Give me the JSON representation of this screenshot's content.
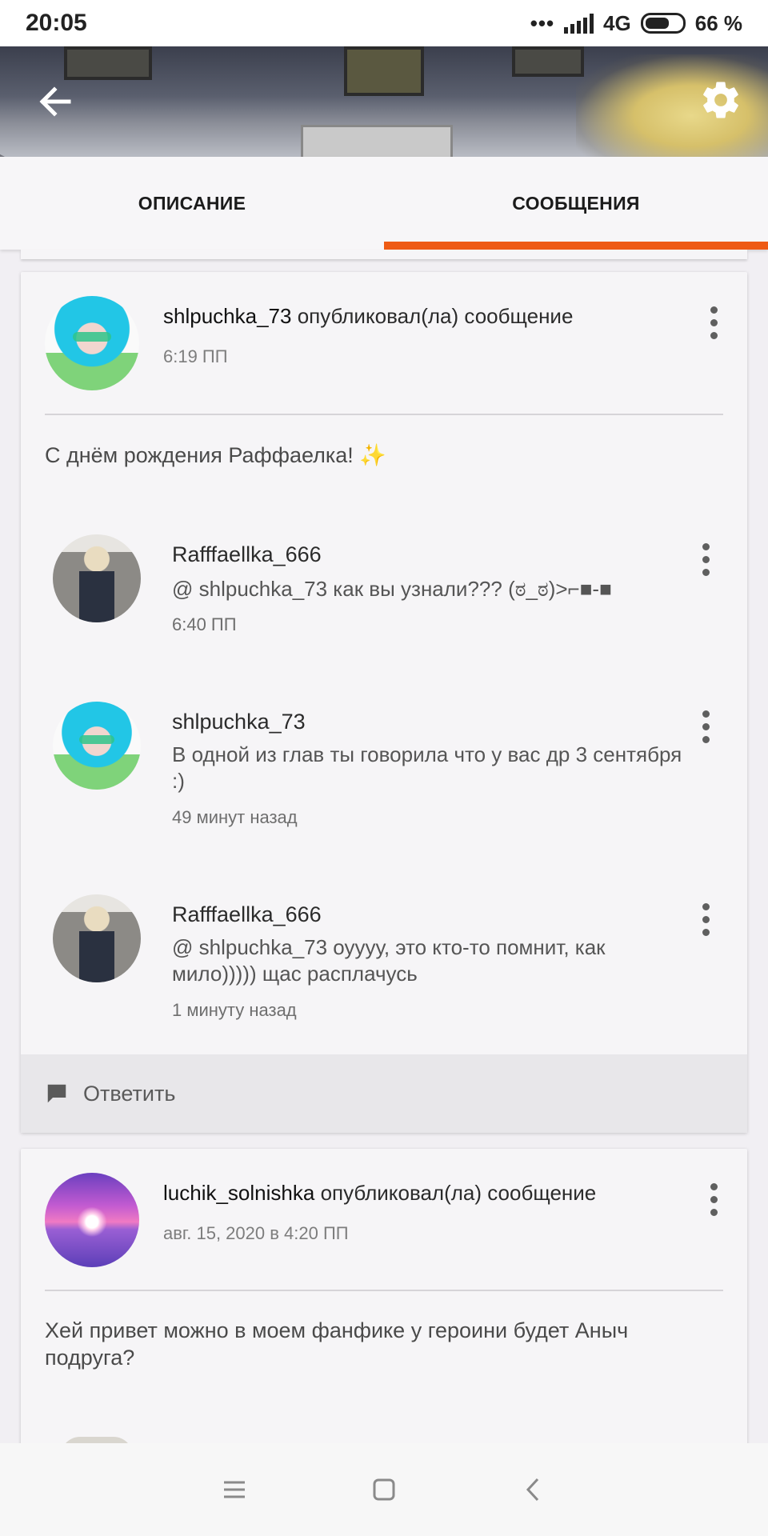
{
  "status_bar": {
    "time": "20:05",
    "network": "4G",
    "battery": "66 %",
    "battery_level": 0.66
  },
  "header": {
    "back_icon": "arrow-left-icon",
    "settings_icon": "gear-icon"
  },
  "tabs": [
    {
      "label": "ОПИСАНИЕ",
      "active": false
    },
    {
      "label": "СООБЩЕНИЯ",
      "active": true
    }
  ],
  "accent_color": "#ee5b14",
  "posts": [
    {
      "author": "shlpuchka_73",
      "action": "опубликовал(ла) сообщение",
      "time": "6:19 ПП",
      "text": "С днём рождения Раффаелка!",
      "emoji": "✨",
      "comments": [
        {
          "author": "Rafffaellka_666",
          "text": "@ shlpuchka_73  как вы узнали???  (ಠ_ಠ)>⌐■-■",
          "time": "6:40 ПП"
        },
        {
          "author": "shlpuchka_73",
          "text": "В одной из глав ты говорила что у вас др 3 сентября :)",
          "time": "49 минут назад"
        },
        {
          "author": "Rafffaellka_666",
          "text": "@ shlpuchka_73  оуууу, это кто-то помнит, как мило))))) щас расплачусь",
          "time": "1 минуту назад"
        }
      ],
      "reply_label": "Ответить"
    },
    {
      "author": "luchik_solnishka",
      "action": "опубликовал(ла) сообщение",
      "time": "авг. 15, 2020 в 4:20 ПП",
      "text": "Хей привет можно в моем фанфике у героини будет Аныч подруга?"
    }
  ],
  "nav_bar": {
    "buttons": [
      "menu-icon",
      "home-square-icon",
      "back-chevron-icon"
    ]
  }
}
